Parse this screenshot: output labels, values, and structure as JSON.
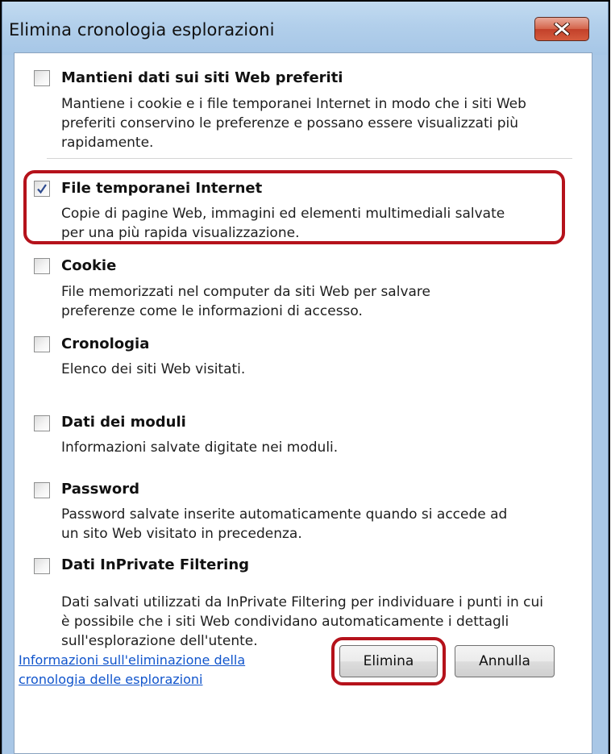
{
  "window": {
    "title": "Elimina cronologia esplorazioni",
    "close_icon": "close-x-icon"
  },
  "options": [
    {
      "id": "preferiti",
      "checked": false,
      "title": "Mantieni dati sui siti Web preferiti",
      "desc": [
        "Mantiene i cookie e i file temporanei Internet in modo che i siti Web",
        "preferiti conservino le preferenze e possano essere visualizzati più",
        "rapidamente."
      ]
    },
    {
      "id": "temporanei",
      "checked": true,
      "title": "File temporanei Internet",
      "desc": [
        "Copie di pagine Web, immagini ed elementi multimediali salvate",
        "per una più rapida visualizzazione."
      ]
    },
    {
      "id": "cookie",
      "checked": false,
      "title": "Cookie",
      "desc": [
        "File memorizzati nel computer da siti Web per salvare",
        "preferenze come le informazioni di accesso."
      ]
    },
    {
      "id": "cronologia",
      "checked": false,
      "title": "Cronologia",
      "desc": [
        "Elenco dei siti Web visitati."
      ]
    },
    {
      "id": "moduli",
      "checked": false,
      "title": "Dati dei moduli",
      "desc": [
        "Informazioni salvate digitate nei moduli."
      ]
    },
    {
      "id": "password",
      "checked": false,
      "title": "Password",
      "desc": [
        "Password salvate inserite automaticamente quando si accede ad",
        "un sito Web visitato in precedenza."
      ]
    },
    {
      "id": "inprivate",
      "checked": false,
      "title": "Dati InPrivate Filtering",
      "desc": [
        "Dati salvati utilizzati da InPrivate Filtering per individuare i punti in cui",
        "è possibile che i siti Web condividano automaticamente i dettagli",
        "sull'esplorazione dell'utente."
      ]
    }
  ],
  "footer": {
    "link_line1": "Informazioni sull'eliminazione della",
    "link_line2": "cronologia delle esplorazioni",
    "delete_label": "Elimina",
    "cancel_label": "Annulla"
  },
  "colors": {
    "highlight": "#b5121b",
    "link": "#1155cc",
    "close_button": "#c2412a"
  }
}
